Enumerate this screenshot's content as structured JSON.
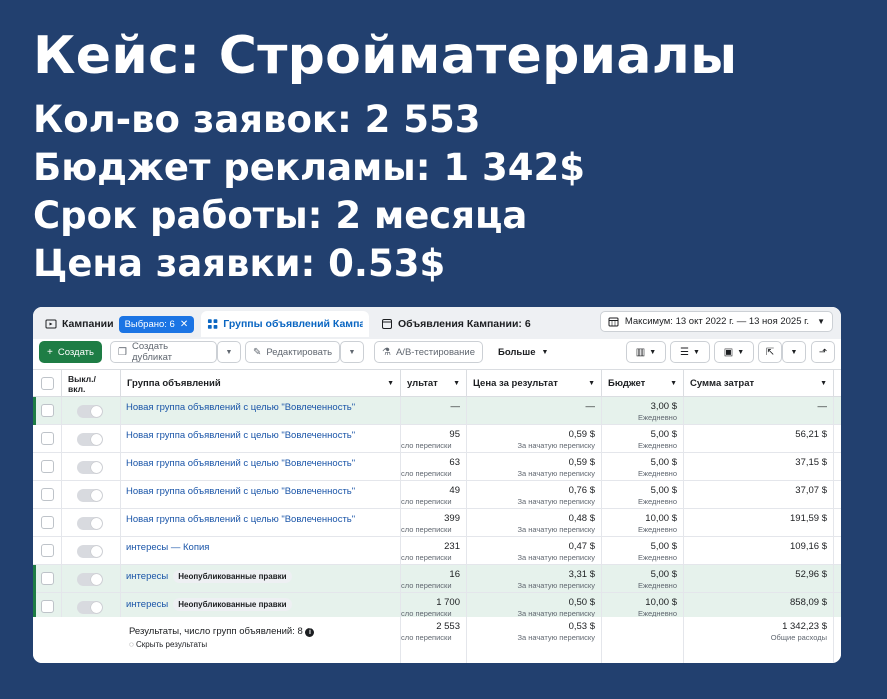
{
  "headline": {
    "title": "Кейс: Стройматериалы",
    "leads": "Кол-во заявок: 2 553",
    "budget": "Бюджет рекламы: 1 342$",
    "duration": "Срок работы: 2 месяца",
    "lead_price": "Цена заявки: 0.53$"
  },
  "tabs": {
    "campaigns": "Кампании",
    "selected_badge": "Выбрано: 6",
    "adsets": "Группы объявлений Кампан",
    "ads": "Объявления Кампании: 6"
  },
  "date_range": "Максимум: 13 окт 2022 г. — 13 ноя 2025 г.",
  "toolbar": {
    "create": "Создать",
    "duplicate": "Создать дубликат",
    "edit": "Редактировать",
    "ab_test": "A/B-тестирование",
    "more": "Больше"
  },
  "columns": {
    "toggle": "Выкл./ вкл.",
    "adset": "Группа объявлений",
    "result": "ультат",
    "cost_per_result": "Цена за результат",
    "budget": "Бюджет",
    "spent": "Сумма затрат"
  },
  "rows": [
    {
      "name": "Новая группа объявлений с целью \"Вовлеченность\"",
      "badge": "",
      "result": "—",
      "result_sub": "",
      "cpr": "—",
      "cpr_sub": "",
      "budget": "3,00 $",
      "budget_sub": "Ежедневно",
      "spent": "—"
    },
    {
      "name": "Новая группа объявлений с целью \"Вовлеченность\"",
      "badge": "",
      "result": "95",
      "result_sub": "сло переписки",
      "cpr": "0,59 $",
      "cpr_sub": "За начатую переписку",
      "budget": "5,00 $",
      "budget_sub": "Ежедневно",
      "spent": "56,21 $"
    },
    {
      "name": "Новая группа объявлений с целью \"Вовлеченность\"",
      "badge": "",
      "result": "63",
      "result_sub": "сло переписки",
      "cpr": "0,59 $",
      "cpr_sub": "За начатую переписку",
      "budget": "5,00 $",
      "budget_sub": "Ежедневно",
      "spent": "37,15 $"
    },
    {
      "name": "Новая группа объявлений с целью \"Вовлеченность\"",
      "badge": "",
      "result": "49",
      "result_sub": "сло переписки",
      "cpr": "0,76 $",
      "cpr_sub": "За начатую переписку",
      "budget": "5,00 $",
      "budget_sub": "Ежедневно",
      "spent": "37,07 $"
    },
    {
      "name": "Новая группа объявлений с целью \"Вовлеченность\"",
      "badge": "",
      "result": "399",
      "result_sub": "сло переписки",
      "cpr": "0,48 $",
      "cpr_sub": "За начатую переписку",
      "budget": "10,00 $",
      "budget_sub": "Ежедневно",
      "spent": "191,59 $"
    },
    {
      "name": "интересы — Копия",
      "badge": "",
      "result": "231",
      "result_sub": "сло переписки",
      "cpr": "0,47 $",
      "cpr_sub": "За начатую переписку",
      "budget": "5,00 $",
      "budget_sub": "Ежедневно",
      "spent": "109,16 $"
    },
    {
      "name": "интересы",
      "badge": "Неопубликованные правки",
      "result": "16",
      "result_sub": "сло переписки",
      "cpr": "3,31 $",
      "cpr_sub": "За начатую переписку",
      "budget": "5,00 $",
      "budget_sub": "Ежедневно",
      "spent": "52,96 $"
    },
    {
      "name": "интересы",
      "badge": "Неопубликованные правки",
      "result": "1 700",
      "result_sub": "сло переписки",
      "cpr": "0,50 $",
      "cpr_sub": "За начатую переписку",
      "budget": "10,00 $",
      "budget_sub": "Ежедневно",
      "spent": "858,09 $"
    }
  ],
  "footer": {
    "title": "Результаты, число групп объявлений: 8",
    "hide": "Скрыть результаты",
    "result": "2 553",
    "result_sub": "сло переписки",
    "cpr": "0,53 $",
    "cpr_sub": "За начатую переписку",
    "spent": "1 342,23 $",
    "spent_sub": "Общие расходы"
  },
  "colors": {
    "background": "#22406f",
    "accent": "#1b74e4",
    "create_button": "#1e7d45",
    "selected_row": "#e6f2ec"
  }
}
